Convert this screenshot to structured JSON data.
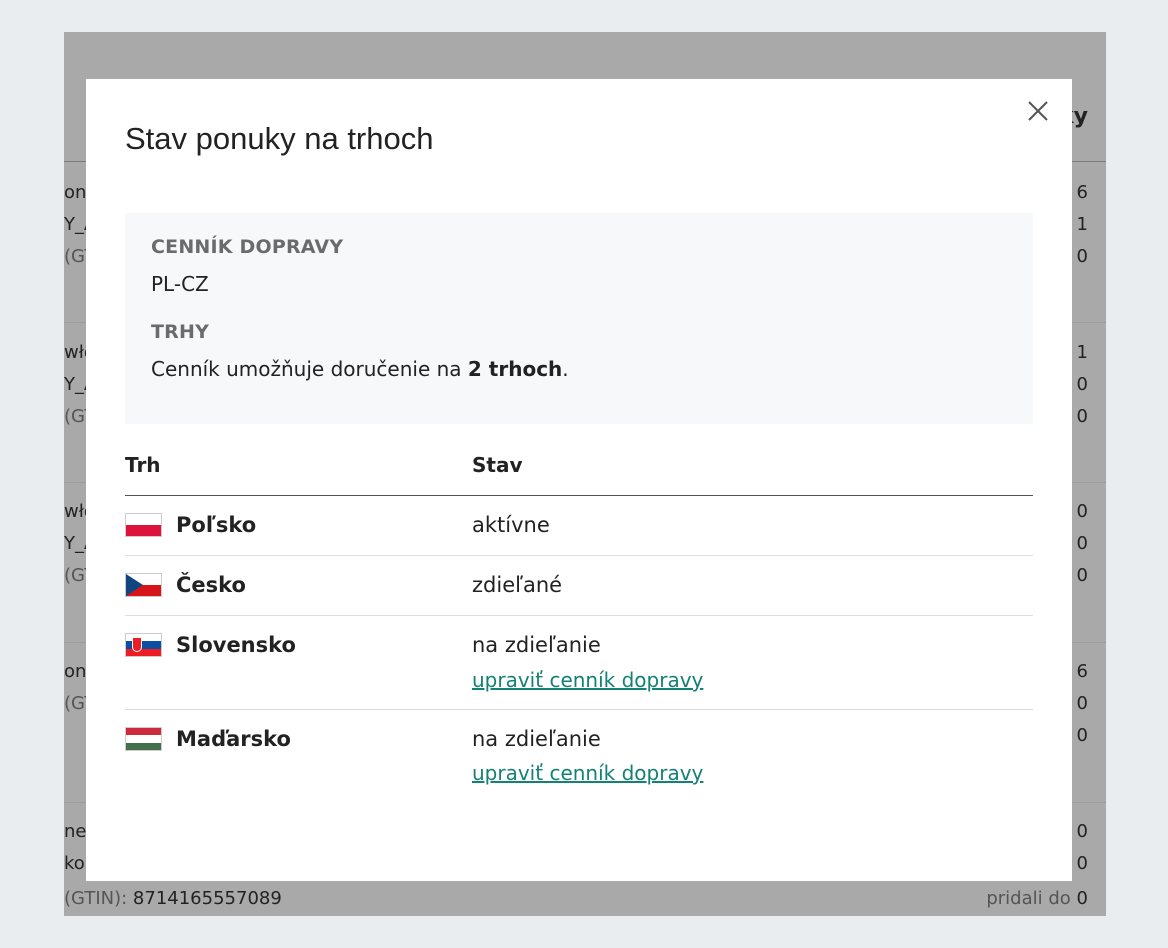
{
  "background_page": {
    "header_partial": "ky",
    "rows": [
      {
        "left": [
          "ond",
          "Y_A",
          "(GTI"
        ],
        "right": [
          "6",
          "1",
          "0"
        ]
      },
      {
        "left": [
          "włó",
          "Y_A",
          "(GTI"
        ],
        "right": [
          "1",
          "0",
          "0"
        ]
      },
      {
        "left": [
          "włó",
          "Y_A",
          "(GTI"
        ],
        "right": [
          "0",
          "0",
          "0"
        ]
      },
      {
        "left": [
          "ond",
          "(GTI",
          ""
        ],
        "right": [
          "6",
          "0",
          "0"
        ]
      },
      {
        "left": [
          "nes",
          "ko",
          ""
        ],
        "right": [
          "0",
          "0",
          ""
        ]
      }
    ],
    "gtin_label": "(GTIN):",
    "gtin_value": "8714165557089",
    "bottom_right_label": "pridali do",
    "bottom_right_value": "0"
  },
  "modal": {
    "title": "Stav ponuky na trhoch",
    "close_icon": "close-icon",
    "info": {
      "price_list_label": "CENNÍK DOPRAVY",
      "price_list_value": "PL-CZ",
      "markets_label": "TRHY",
      "markets_text_before": "Cenník umožňuje doručenie na ",
      "markets_count": "2 trhoch",
      "markets_text_after": "."
    },
    "table": {
      "headers": {
        "market": "Trh",
        "status": "Stav"
      },
      "rows": [
        {
          "flag": "flag-pl",
          "country": "Poľsko",
          "status": "aktívne",
          "action": null
        },
        {
          "flag": "flag-cz",
          "country": "Česko",
          "status": "zdieľané",
          "action": null
        },
        {
          "flag": "flag-sk",
          "country": "Slovensko",
          "status": "na zdieľanie",
          "action": "upraviť cenník dopravy"
        },
        {
          "flag": "flag-hu",
          "country": "Maďarsko",
          "status": "na zdieľanie",
          "action": "upraviť cenník dopravy"
        }
      ]
    }
  },
  "colors": {
    "overlay_page": "#a9a9a9",
    "body_bg": "#eaedf0",
    "link": "#138275",
    "info_bg": "#f7f8fa"
  }
}
